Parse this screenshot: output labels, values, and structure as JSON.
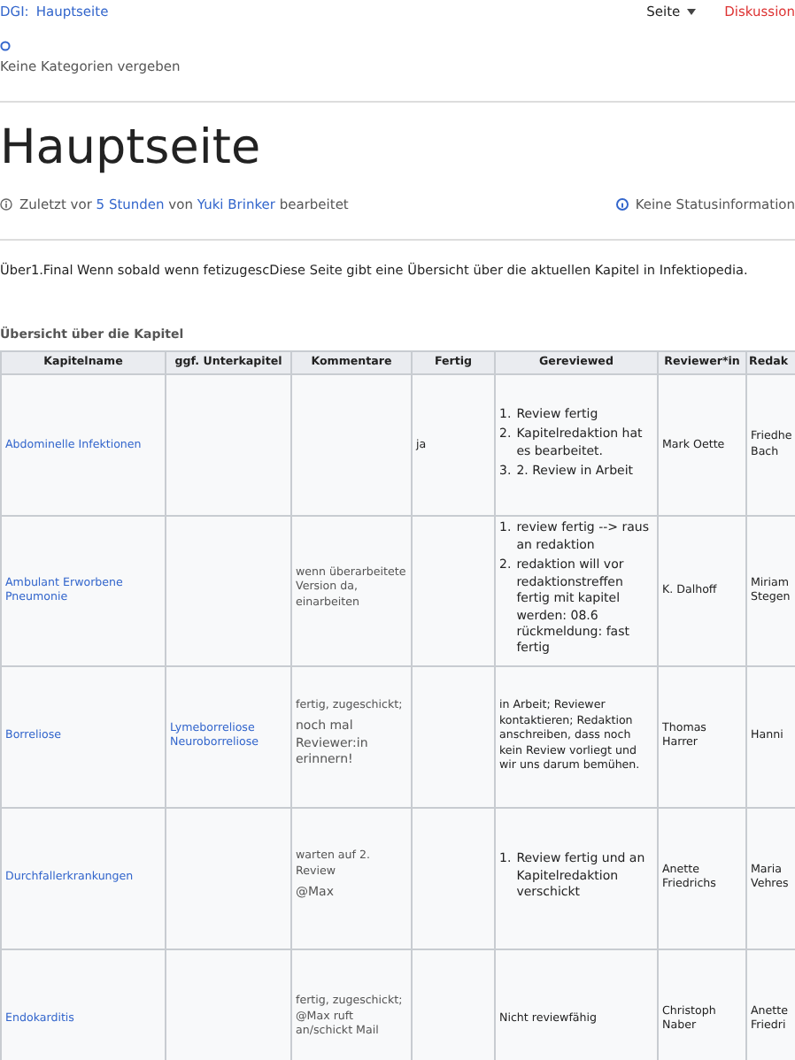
{
  "topbar": {
    "prefix": "DGI:",
    "page_link": "Hauptseite",
    "menu": "Seite",
    "discussion": "Diskussion"
  },
  "categories": "Keine Kategorien vergeben",
  "title": "Hauptseite",
  "edit_info": {
    "before": "Zuletzt vor",
    "time": "5 Stunden",
    "middle": "von",
    "user": "Yuki Brinker",
    "after": "bearbeitet"
  },
  "status": "Keine Statusinformation",
  "intro": "Über1.Final Wenn sobald wenn fetizugescDiese Seite gibt eine Übersicht über die aktuellen Kapitel in Infektiopedia.",
  "table": {
    "caption": "Übersicht über die Kapitel",
    "columns": [
      "Kapitelname",
      "ggf. Unterkapitel",
      "Kommentare",
      "Fertig",
      "Gereviewed",
      "Reviewer*in",
      "Redak"
    ],
    "rows": [
      {
        "chapter": "Abdominelle Infektionen",
        "subchapters": [],
        "comments": [],
        "done": "ja",
        "review": {
          "kind": "list",
          "items": [
            {
              "marker": "1.",
              "text": "Review fertig"
            },
            {
              "marker": "2.",
              "text": "Kapitelredaktion hat es bearbeitet."
            },
            {
              "marker": "3.",
              "text": "2. Review in Arbeit"
            }
          ]
        },
        "reviewer": "Mark Oette",
        "editor": [
          "Friedhe",
          "Bach"
        ]
      },
      {
        "chapter": "Ambulant Erworbene Pneumonie",
        "subchapters": [],
        "comments": [
          "wenn überarbeitete Version da, einarbeiten"
        ],
        "done": "",
        "review": {
          "kind": "list",
          "items": [
            {
              "marker": "1.",
              "text": "review fertig --> raus an redaktion"
            },
            {
              "marker": "2.",
              "text": "redaktion will vor redaktionstreffen fertig mit kapitel werden: 08.6 rückmeldung: fast fertig"
            }
          ]
        },
        "reviewer": "K. Dalhoff",
        "editor": [
          "Miriam",
          "Stegen"
        ]
      },
      {
        "chapter": "Borreliose",
        "subchapters": [
          "Lymeborreliose",
          "Neuroborreliose"
        ],
        "comments": [
          "fertig, zugeschickt;",
          "noch mal Reviewer:in erinnern!"
        ],
        "done": "",
        "review": {
          "kind": "text",
          "text": "in Arbeit; Reviewer kontaktieren; Redaktion anschreiben, dass noch kein Review vorliegt und wir uns darum bemühen."
        },
        "reviewer": "Thomas Harrer",
        "editor": [
          "Hanni"
        ]
      },
      {
        "chapter": "Durchfallerkrankungen",
        "subchapters": [],
        "comments": [
          "warten auf 2. Review",
          "@Max"
        ],
        "done": "",
        "review": {
          "kind": "list",
          "items": [
            {
              "marker": "1.",
              "text": "Review fertig und an Kapitelredaktion verschickt"
            }
          ]
        },
        "reviewer": "Anette Friedrichs",
        "editor": [
          "Maria",
          "Vehres"
        ]
      },
      {
        "chapter": "Endokarditis",
        "subchapters": [],
        "comments": [
          "fertig, zugeschickt; @Max ruft an/schickt Mail"
        ],
        "done": "",
        "review": {
          "kind": "text",
          "text": "Nicht reviewfähig"
        },
        "reviewer": "Christoph Naber",
        "editor": [
          "Anette",
          "Friedri"
        ]
      }
    ]
  }
}
